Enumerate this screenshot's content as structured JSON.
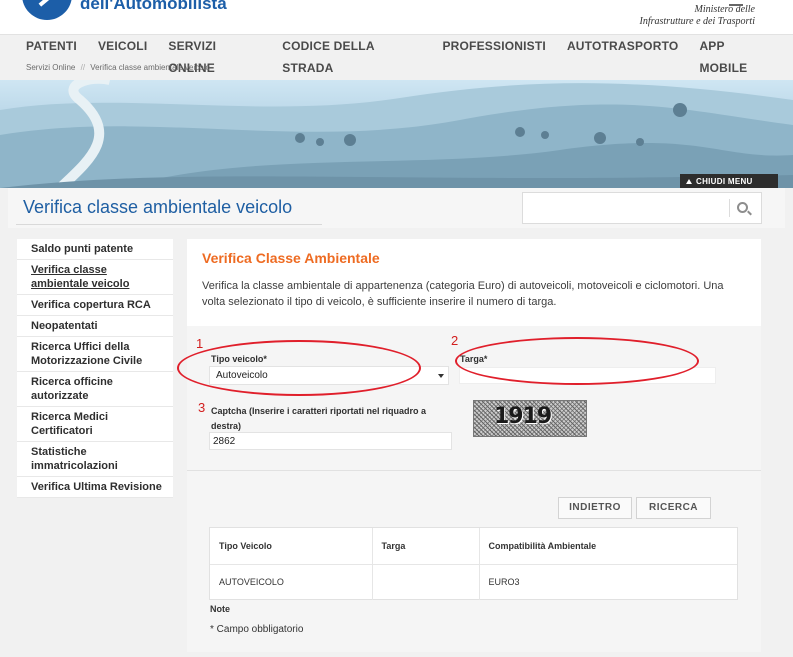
{
  "header": {
    "logo_text": "dell'Automobilista",
    "ministry_line1": "Ministero delle",
    "ministry_line2": "Infrastrutture e dei Trasporti"
  },
  "nav": {
    "items": [
      "PATENTI",
      "VEICOLI",
      "SERVIZI ONLINE",
      "CODICE DELLA STRADA",
      "PROFESSIONISTI",
      "AUTOTRASPORTO",
      "APP MOBILE"
    ]
  },
  "breadcrumb": {
    "root": "Servizi Online",
    "separator": "//",
    "current": "Verifica classe ambientale veicolo"
  },
  "hero": {
    "close_menu_label": "CHIUDI MENU"
  },
  "page": {
    "title": "Verifica classe ambientale veicolo",
    "search_placeholder": ""
  },
  "sidebar": {
    "items": [
      "Saldo punti patente",
      "Verifica classe ambientale veicolo",
      "Verifica copertura RCA",
      "Neopatentati",
      "Ricerca Uffici della Motorizzazione Civile",
      "Ricerca officine autorizzate",
      "Ricerca Medici Certificatori",
      "Statistiche immatricolazioni",
      "Verifica Ultima Revisione"
    ]
  },
  "panel": {
    "heading": "Verifica Classe Ambientale",
    "description": "Verifica la classe ambientale di appartenenza (categoria Euro) di autoveicoli, motoveicoli e ciclomotori. Una volta selezionato il tipo di veicolo, è sufficiente inserire il numero di targa."
  },
  "form": {
    "tipo_label": "Tipo veicolo*",
    "tipo_value": "Autoveicolo",
    "targa_label": "Targa*",
    "targa_value": "",
    "captcha_label": "Captcha (Inserire i caratteri riportati nel riquadro a destra)",
    "captcha_value": "2862",
    "captcha_image_text": "1919"
  },
  "annotations": {
    "n1": "1",
    "n2": "2",
    "n3": "3",
    "color": "#e01f2b"
  },
  "buttons": {
    "back": "INDIETRO",
    "search": "RICERCA"
  },
  "results": {
    "headers": [
      "Tipo Veicolo",
      "Targa",
      "Compatibilità Ambientale"
    ],
    "row": [
      "AUTOVEICOLO",
      "",
      "EURO3"
    ]
  },
  "notes": {
    "title": "Note",
    "required": "* Campo obbligatorio"
  },
  "colors": {
    "brand_blue": "#1f5fa3",
    "accent_orange": "#ee6b22"
  }
}
